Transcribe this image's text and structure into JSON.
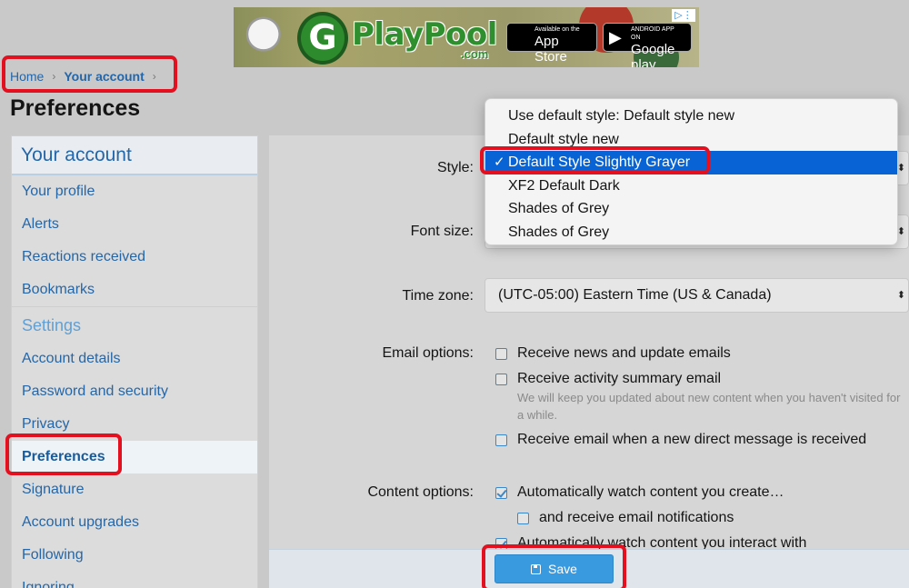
{
  "ad": {
    "brand": "PlayPool",
    "brand_sub": ".com",
    "logo_letter": "G",
    "appstore_small": "Available on the",
    "appstore_big": "App Store",
    "googleplay_small": "ANDROID APP ON",
    "googleplay_big": "Google play"
  },
  "breadcrumb": {
    "home": "Home",
    "current": "Your account"
  },
  "page_title": "Preferences",
  "sidebar": {
    "header": "Your account",
    "items_top": [
      "Your profile",
      "Alerts",
      "Reactions received",
      "Bookmarks"
    ],
    "settings_label": "Settings",
    "items_settings": [
      "Account details",
      "Password and security",
      "Privacy",
      "Preferences",
      "Signature",
      "Account upgrades",
      "Following",
      "Ignoring"
    ],
    "active_item": "Preferences"
  },
  "form": {
    "style_label": "Style:",
    "font_size_label": "Font size:",
    "timezone_label": "Time zone:",
    "timezone_value": "(UTC-05:00) Eastern Time (US & Canada)",
    "email_label": "Email options:",
    "email_options": [
      {
        "label": "Receive news and update emails",
        "checked": false
      },
      {
        "label": "Receive activity summary email",
        "checked": false,
        "hint": "We will keep you updated about new content when you haven't visited for a while."
      },
      {
        "label": "Receive email when a new direct message is received",
        "checked": false
      }
    ],
    "content_label": "Content options:",
    "content_options": [
      {
        "label": "Automatically watch content you create…",
        "checked": true
      },
      {
        "label": "and receive email notifications",
        "checked": false
      },
      {
        "label": "Automatically watch content you interact with",
        "checked": true
      }
    ],
    "save_label": "Save"
  },
  "style_dropdown": {
    "options": [
      "Use default style: Default style new",
      "Default style new",
      "Default Style Slightly Grayer",
      "XF2 Default Dark",
      "Shades of Grey",
      "Shades of Grey"
    ],
    "selected": "Default Style Slightly Grayer",
    "tick": "✓"
  },
  "colors": {
    "link": "#2466a8",
    "highlight_annotation": "#e5101f",
    "save_button": "#3a9ae0",
    "dropdown_selected": "#0864d4"
  }
}
